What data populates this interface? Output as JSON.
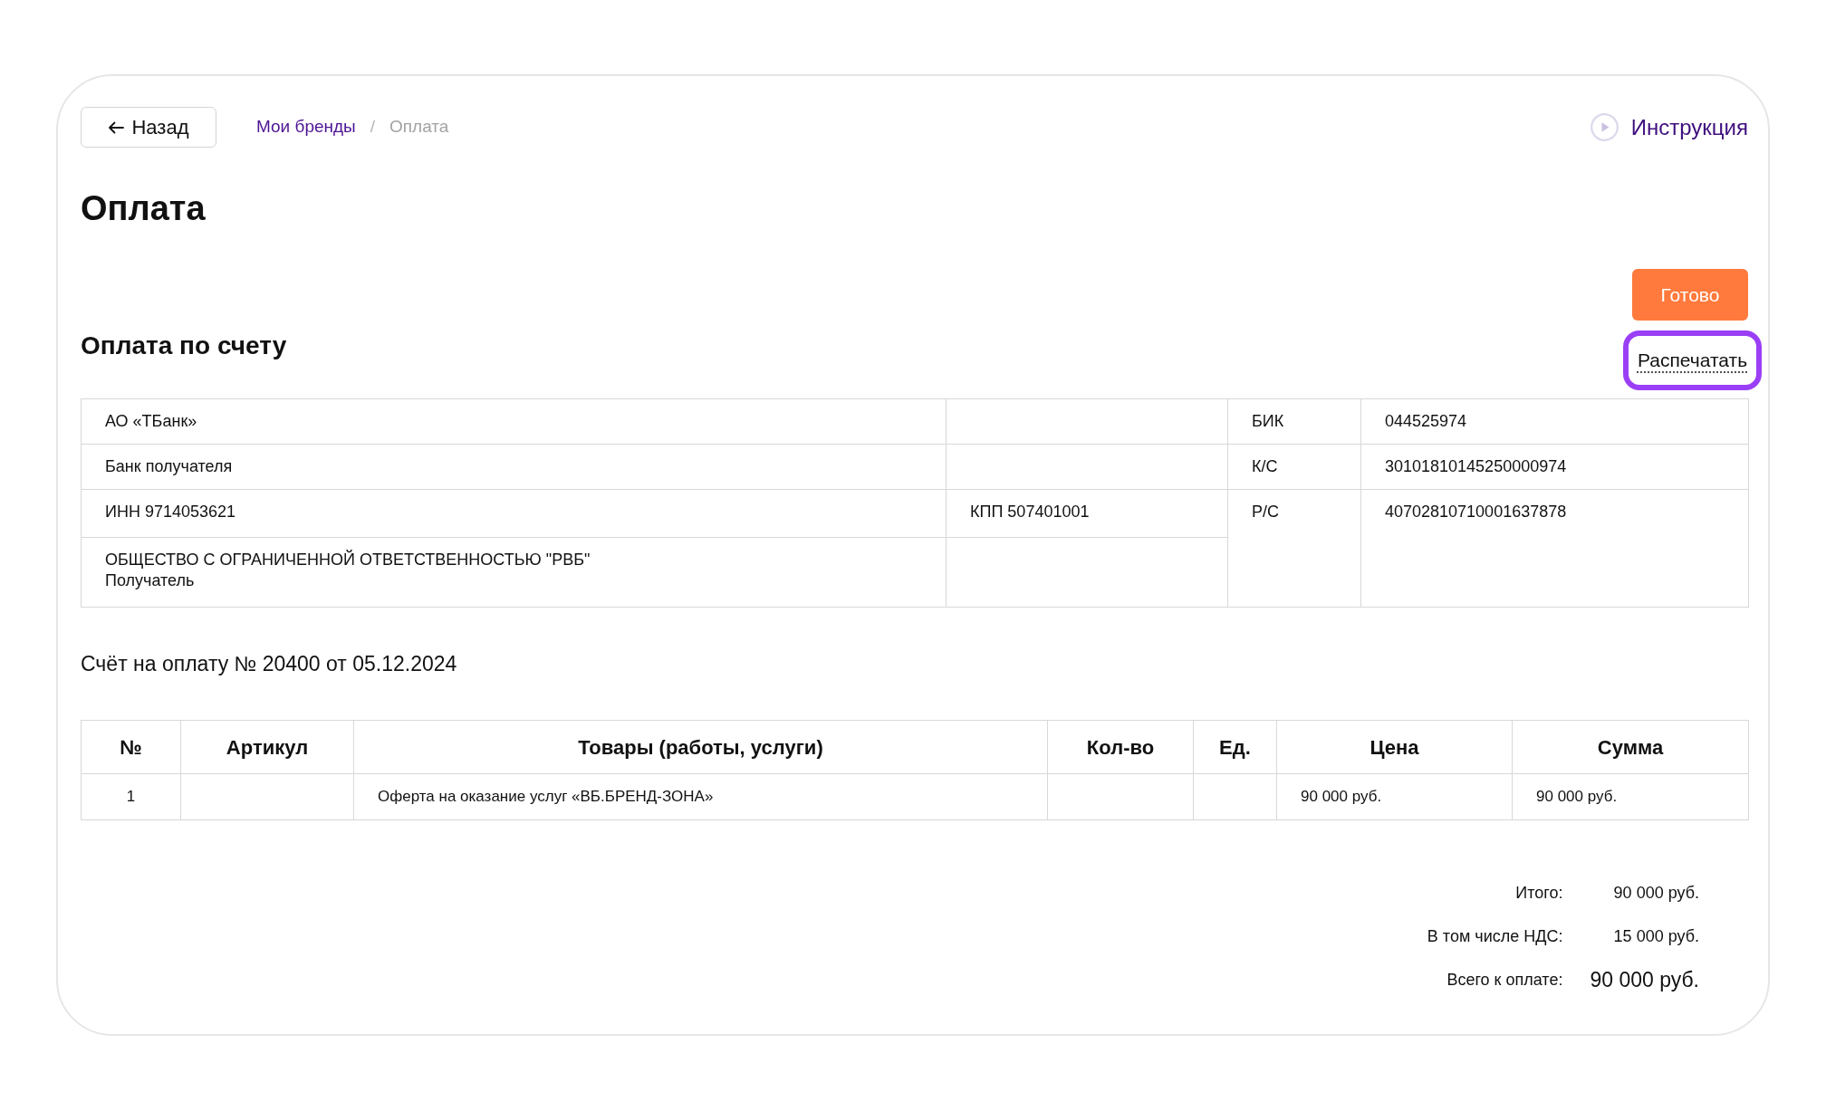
{
  "back_button": {
    "label": "Назад"
  },
  "breadcrumb": {
    "separator": "/",
    "items": [
      {
        "label": "Мои бренды",
        "current": false
      },
      {
        "label": "Оплата",
        "current": true
      }
    ]
  },
  "instruction_link": {
    "label": "Инструкция"
  },
  "title": "Оплата",
  "done_button": {
    "label": "Готово"
  },
  "section_title": "Оплата по счету",
  "print_button": {
    "label": "Распечатать",
    "highlighted": true
  },
  "bank_details": {
    "bank_name": "АО «ТБанк»",
    "bank_caption": "Банк получателя",
    "inn": "ИНН 9714053621",
    "kpp": "КПП 507401001",
    "recipient_name": "ОБЩЕСТВО С ОГРАНИЧЕННОЙ ОТВЕТСТВЕННОСТЬЮ \"РВБ\"",
    "recipient_caption": "Получатель",
    "codes": [
      {
        "label": "БИК",
        "value": "044525974"
      },
      {
        "label": "К/С",
        "value": "30101810145250000974"
      },
      {
        "label": "Р/С",
        "value": "40702810710001637878"
      }
    ]
  },
  "invoice_title": "Счёт на оплату № 20400 от 05.12.2024",
  "items_table": {
    "columns": [
      "№",
      "Артикул",
      "Товары (работы, услуги)",
      "Кол-во",
      "Ед.",
      "Цена",
      "Сумма"
    ],
    "rows": [
      {
        "number": "1",
        "product": "Оферта на оказание услуг «ВБ.БРЕНД-ЗОНА»",
        "price": "90 000 руб.",
        "total": "90 000 руб."
      }
    ]
  },
  "totals": [
    {
      "kind": "normal",
      "label": "Итого:",
      "value": "90 000 руб."
    },
    {
      "kind": "normal",
      "label": "В том числе НДС:",
      "value": "15 000 руб."
    },
    {
      "kind": "grand",
      "label": "Всего к оплате:",
      "value": "90 000 руб."
    }
  ]
}
